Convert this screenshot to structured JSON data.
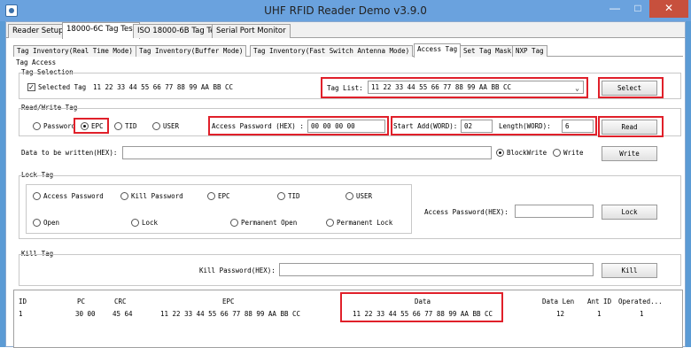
{
  "window": {
    "title": "UHF RFID Reader Demo v3.9.0",
    "minimize": "—",
    "maximize": "□",
    "close": "✕"
  },
  "main_tabs": [
    "Reader Setup",
    "18000-6C Tag Test",
    "ISO 18000-6B Tag Test",
    "Serial Port Monitor"
  ],
  "sub_tabs": [
    "Tag Inventory(Real Time Mode)",
    "Tag Inventory(Buffer Mode)",
    "Tag Inventory(Fast Switch Antenna Mode)",
    "Access Tag",
    "Set Tag Mask",
    "NXP Tag"
  ],
  "access": {
    "group_title": "Tag Access",
    "selection_title": "Tag Selection",
    "selected_tag_label": "Selected Tag",
    "selected_tag_value": "11 22 33 44 55 66 77 88 99 AA BB CC",
    "tag_list_label": "Tag List:",
    "tag_list_value": "11 22 33 44 55 66 77 88 99 AA BB CC",
    "select_button": "Select"
  },
  "readwrite": {
    "title": "Read/Write Tag",
    "radio_password": "Password",
    "radio_epc": "EPC",
    "radio_tid": "TID",
    "radio_user": "USER",
    "access_pwd_label": "Access Password (HEX) :",
    "access_pwd_value": "00 00 00 00",
    "start_add_label": "Start Add(WORD):",
    "start_add_value": "02",
    "length_label": "Length(WORD):",
    "length_value": "6",
    "read_button": "Read",
    "data_label": "Data to be written(HEX):",
    "data_value": "",
    "blockwrite": "BlockWrite",
    "write_radio": "Write",
    "write_button": "Write"
  },
  "lock": {
    "title": "Lock Tag",
    "access_password": "Access Password",
    "kill_password": "Kill Password",
    "epc": "EPC",
    "tid": "TID",
    "user": "USER",
    "open": "Open",
    "lock": "Lock",
    "permanent_open": "Permanent Open",
    "permanent_lock": "Permanent Lock",
    "access_pwd_label": "Access Password(HEX):",
    "access_pwd_value": "",
    "lock_button": "Lock"
  },
  "kill": {
    "title": "Kill Tag",
    "kill_pwd_label": "Kill Password(HEX):",
    "kill_pwd_value": "",
    "kill_button": "Kill"
  },
  "grid": {
    "headers": [
      "ID",
      "PC",
      "CRC",
      "EPC",
      "Data",
      "Data Len",
      "Ant ID",
      "Operated..."
    ],
    "rows": [
      [
        "1",
        "30 00",
        "45 64",
        "11 22 33 44 55 66 77 88 99 AA BB CC",
        "11 22 33 44 55 66 77 88 99 AA BB CC",
        "12",
        "1",
        "1"
      ]
    ]
  },
  "colors": {
    "highlight": "#e0202a",
    "titlebar": "#6aa2de",
    "close": "#c7503d"
  }
}
